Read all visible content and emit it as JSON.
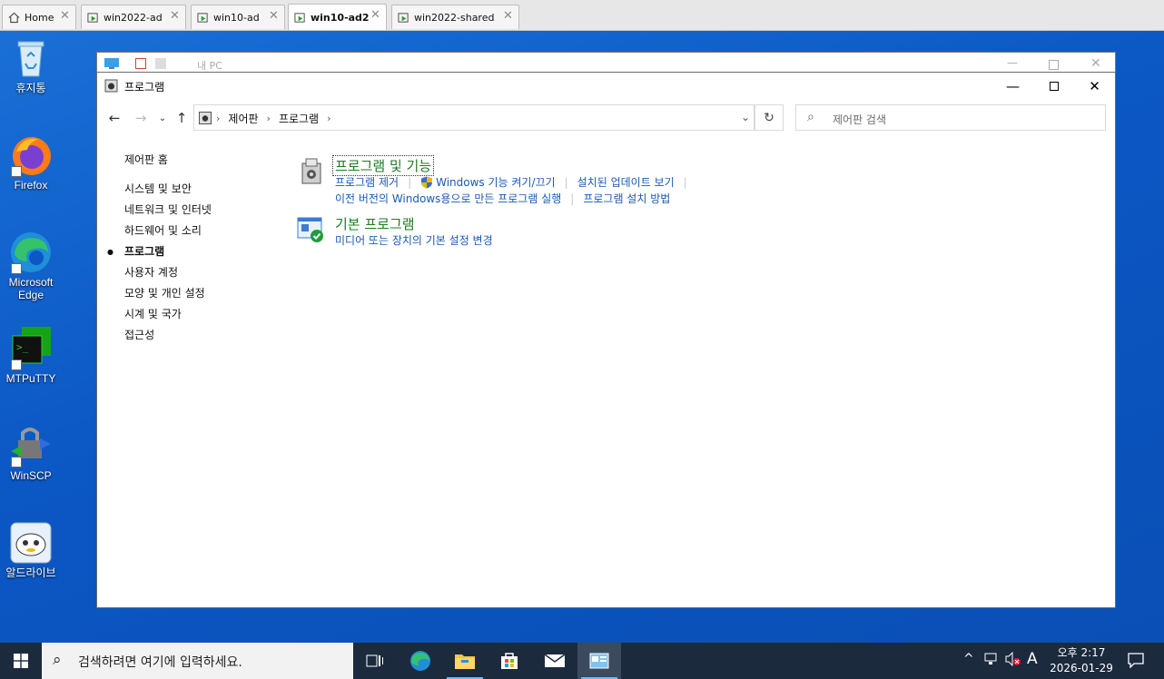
{
  "tabs": [
    {
      "label": "Home",
      "icon": "home-icon",
      "active": false
    },
    {
      "label": "win2022-ad",
      "icon": "vm-console-icon",
      "active": false
    },
    {
      "label": "win10-ad",
      "icon": "vm-console-icon",
      "active": false
    },
    {
      "label": "win10-ad2",
      "icon": "vm-console-icon",
      "active": true
    },
    {
      "label": "win2022-shared",
      "icon": "vm-console-icon",
      "active": false
    }
  ],
  "desktop_icons": [
    {
      "label": "휴지통",
      "icon": "recycle-bin-icon"
    },
    {
      "label": "Firefox",
      "icon": "firefox-icon"
    },
    {
      "label": "Microsoft Edge",
      "icon": "edge-icon"
    },
    {
      "label": "MTPuTTY",
      "icon": "mtputty-icon"
    },
    {
      "label": "WinSCP",
      "icon": "winscp-icon"
    },
    {
      "label": "알드라이브",
      "icon": "aldrive-icon"
    }
  ],
  "bg_window": {
    "title": "내 PC"
  },
  "window": {
    "title": "프로그램",
    "breadcrumb": [
      "제어판",
      "프로그램"
    ],
    "search_placeholder": "제어판 검색"
  },
  "leftnav": {
    "home": "제어판 홈",
    "items": [
      "시스템 및 보안",
      "네트워크 및 인터넷",
      "하드웨어 및 소리",
      "프로그램",
      "사용자 계정",
      "모양 및 개인 설정",
      "시계 및 국가",
      "접근성"
    ],
    "current": "프로그램"
  },
  "categories": [
    {
      "title": "프로그램 및 기능",
      "links_row1": [
        "프로그램 제거",
        "Windows 기능 켜기/끄기",
        "설치된 업데이트 보기"
      ],
      "links_row2": [
        "이전 버전의 Windows용으로 만든 프로그램 실행",
        "프로그램 설치 방법"
      ]
    },
    {
      "title": "기본 프로그램",
      "links_row1": [
        "미디어 또는 장치의 기본 설정 변경"
      ]
    }
  ],
  "taskbar": {
    "search_placeholder": "검색하려면 여기에 입력하세요.",
    "ime": "A",
    "time": "오후 2:17",
    "date": "2026-01-29"
  },
  "colors": {
    "desktop": "#0b57c4",
    "category_title": "#1e7b22",
    "link": "#1a59b5",
    "taskbar": "#1c2a3d"
  }
}
